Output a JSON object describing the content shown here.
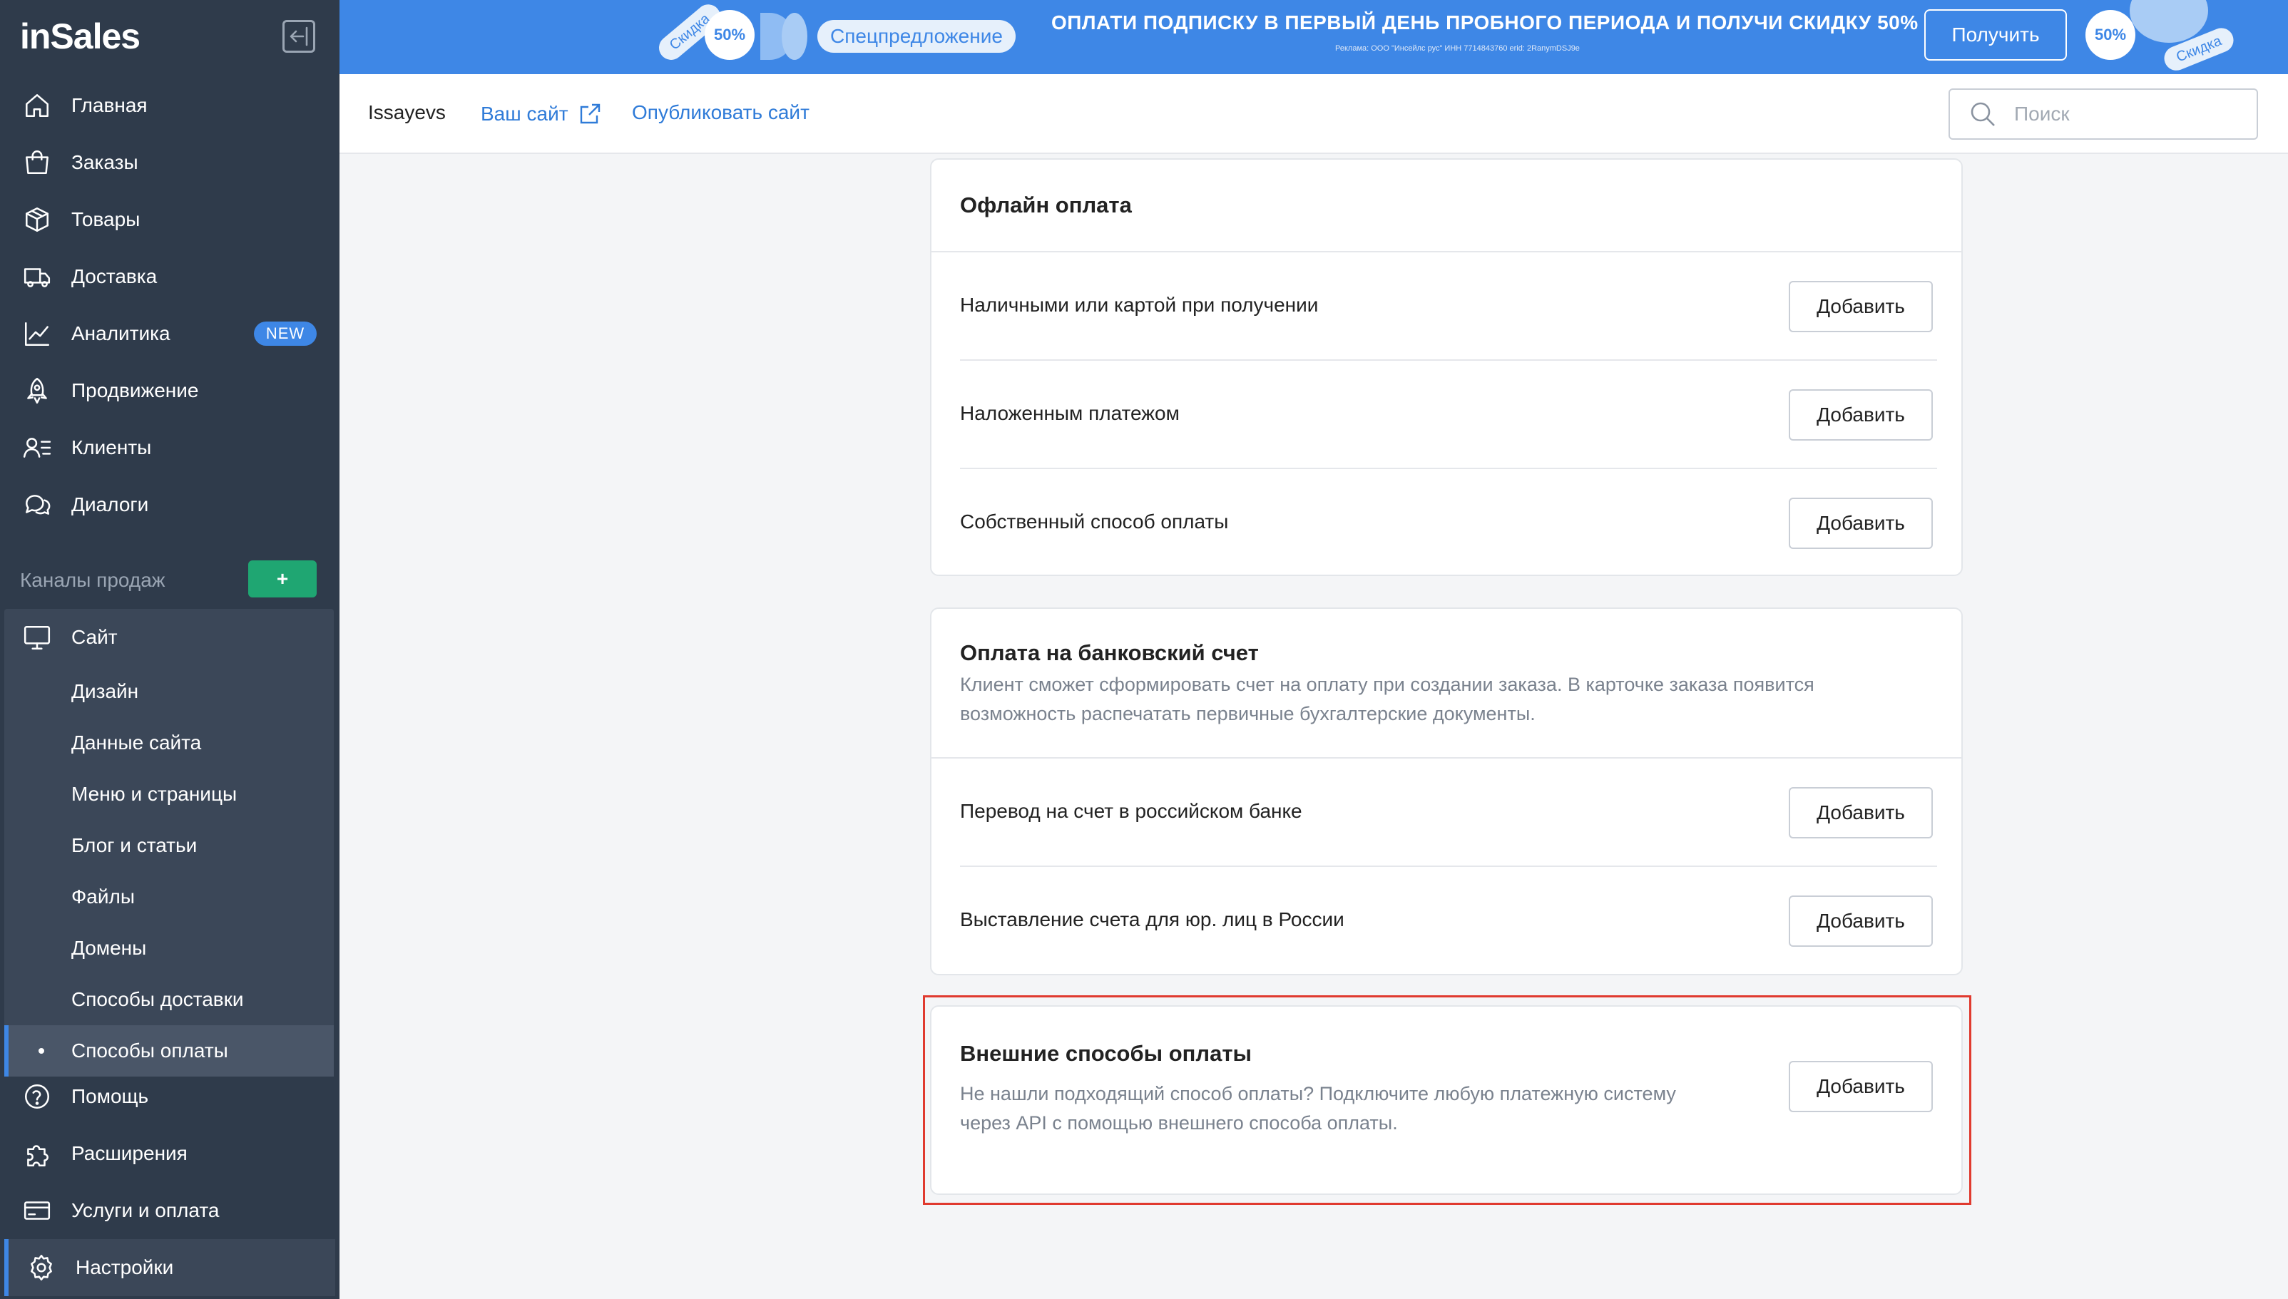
{
  "sidebar": {
    "logo": "inSales",
    "main_items": [
      {
        "label": "Главная",
        "icon": "home-icon"
      },
      {
        "label": "Заказы",
        "icon": "shopping-bag-icon"
      },
      {
        "label": "Товары",
        "icon": "box-icon"
      },
      {
        "label": "Доставка",
        "icon": "truck-icon"
      },
      {
        "label": "Аналитика",
        "icon": "chart-icon",
        "badge": "NEW"
      },
      {
        "label": "Продвижение",
        "icon": "rocket-icon"
      },
      {
        "label": "Клиенты",
        "icon": "users-list-icon"
      },
      {
        "label": "Диалоги",
        "icon": "chat-icon"
      }
    ],
    "channels_label": "Каналы продаж",
    "channels_add": "+",
    "site": {
      "label": "Сайт",
      "sub_items": [
        "Дизайн",
        "Данные сайта",
        "Меню и страницы",
        "Блог и статьи",
        "Файлы",
        "Домены",
        "Способы доставки",
        "Способы оплаты"
      ],
      "active_sub": "Способы оплаты"
    },
    "bottom_items": [
      {
        "label": "Помощь",
        "icon": "help-icon"
      },
      {
        "label": "Расширения",
        "icon": "puzzle-icon"
      },
      {
        "label": "Услуги и оплата",
        "icon": "credit-card-icon"
      },
      {
        "label": "Настройки",
        "icon": "gear-icon"
      }
    ]
  },
  "promo": {
    "stamp_left": "50%",
    "tag_left": "Скидка",
    "offer": "Спецпредложение",
    "text": "ОПЛАТИ ПОДПИСКУ В ПЕРВЫЙ ДЕНЬ ПРОБНОГО ПЕРИОДА И ПОЛУЧИ СКИДКУ 50%",
    "legal": "Реклама: ООО \"Инсейлс рус\" ИНН 7714843760 erid: 2RanymDSJ9e",
    "button": "Получить",
    "stamp_right": "50%",
    "tag_right": "Скидка"
  },
  "topbar": {
    "shop_name": "Issayevs",
    "site_link": "Ваш сайт",
    "publish_link": "Опубликовать сайт",
    "search_placeholder": "Поиск"
  },
  "offline": {
    "title": "Офлайн оплата",
    "rows": [
      "Наличными или картой при получении",
      "Наложенным платежом",
      "Собственный способ оплаты"
    ]
  },
  "bank": {
    "title": "Оплата на банковский счет",
    "desc_line1": "Клиент сможет сформировать счет на оплату при создании заказа. В карточке заказа появится",
    "desc_line2": "возможность распечатать первичные бухгалтерские документы.",
    "rows": [
      "Перевод на счет в российском банке",
      "Выставление счета для юр. лиц в России"
    ]
  },
  "external": {
    "title": "Внешние способы оплаты",
    "desc_line1": "Не нашли подходящий способ оплаты? Подключите любую платежную систему",
    "desc_line2": "через API с помощью внешнего способа оплаты."
  },
  "add_label": "Добавить",
  "colors": {
    "sidebar_bg": "#2f3b4b",
    "accent": "#3e87e6",
    "green": "#1fa672",
    "highlight": "#e03a2f"
  }
}
